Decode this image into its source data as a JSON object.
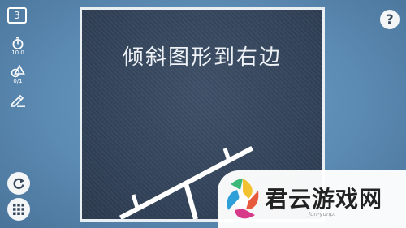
{
  "level": "3",
  "stats": {
    "timer_value": "10.0",
    "shapes_value": "0/1"
  },
  "icons": {
    "timer": "stopwatch-icon",
    "shapes": "shapes-icon",
    "draw": "pencil-icon",
    "help": "help-icon",
    "restart": "restart-icon",
    "menu": "grid-menu-icon"
  },
  "help_label": "?",
  "board": {
    "instruction": "倾斜图形到右边",
    "seesaw_tilt": "toward right"
  },
  "watermark": {
    "text": "君云游戏网",
    "sub": "Jun-yunp."
  },
  "colors": {
    "background": "#5b8ab2",
    "board": "#33435a",
    "board_border": "#e9eef3",
    "seesaw": "#ffffff"
  }
}
